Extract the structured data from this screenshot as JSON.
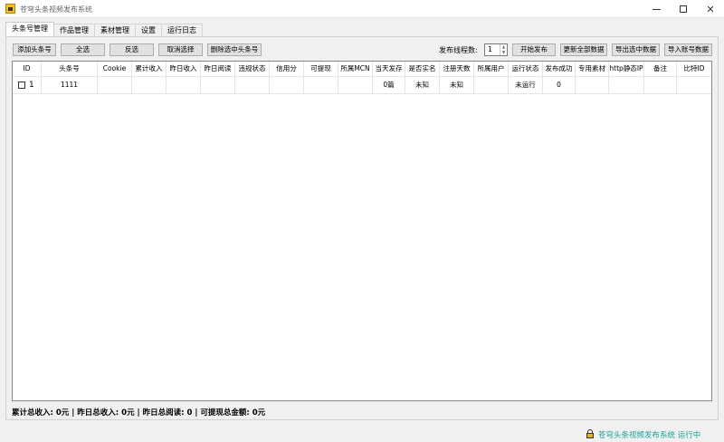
{
  "window": {
    "title": "苍穹头条视频发布系统"
  },
  "tabs": [
    "头条号管理",
    "作品管理",
    "素材管理",
    "设置",
    "运行日志"
  ],
  "toolbar": {
    "add": "添加头条号",
    "select_all": "全选",
    "invert": "反选",
    "deselect": "取消选择",
    "delete_selected": "删除选中头条号",
    "thread_label": "发布线程数:",
    "thread_value": "1",
    "start": "开始发布",
    "update_all": "更新全部数据",
    "export_selected": "导出选中数据",
    "import": "导入账号数据"
  },
  "table": {
    "headers": [
      "ID",
      "头条号",
      "Cookie",
      "累计收入",
      "昨日收入",
      "昨日阅读",
      "违规状态",
      "信用分",
      "可提现",
      "所属MCN",
      "当天发存",
      "是否实名",
      "注册天数",
      "所属用户",
      "运行状态",
      "发布成功",
      "专用素材",
      "http静态IP",
      "备注",
      "比特ID"
    ],
    "rows": [
      [
        "1",
        "1111",
        "",
        "",
        "",
        "",
        "",
        "",
        "",
        "",
        "0篇",
        "未知",
        "未知",
        "",
        "未运行",
        "0",
        "",
        "",
        "",
        ""
      ]
    ]
  },
  "summary": "累计总收入: 0元 | 昨日总收入: 0元 | 昨日总阅读: 0 | 可提现总金额: 0元",
  "status": "苍穹头条视频发布系统 运行中"
}
